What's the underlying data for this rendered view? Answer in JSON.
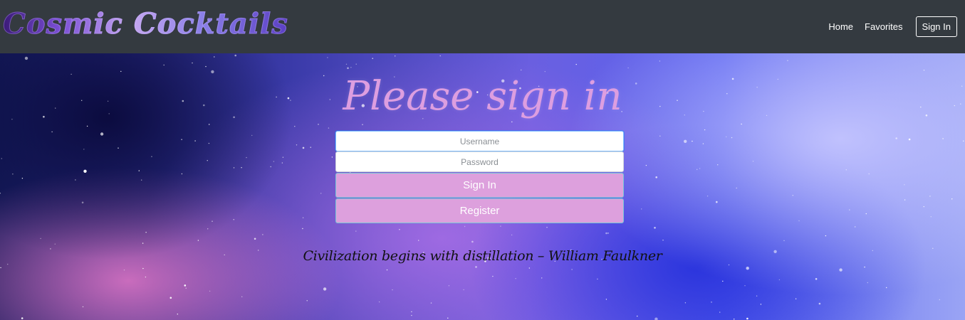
{
  "navbar": {
    "brand": "Cosmic Cocktails",
    "links": [
      {
        "label": "Home"
      },
      {
        "label": "Favorites"
      }
    ],
    "signin_label": "Sign In",
    "background_color": "#343a40"
  },
  "main": {
    "title": "Please sign in",
    "username": {
      "placeholder": "Username",
      "value": ""
    },
    "password": {
      "placeholder": "Password",
      "value": ""
    },
    "signin_button": "Sign In",
    "register_button": "Register",
    "button_color": "#dda0dd",
    "quote": "Civilization begins with distillation – William Faulkner"
  }
}
